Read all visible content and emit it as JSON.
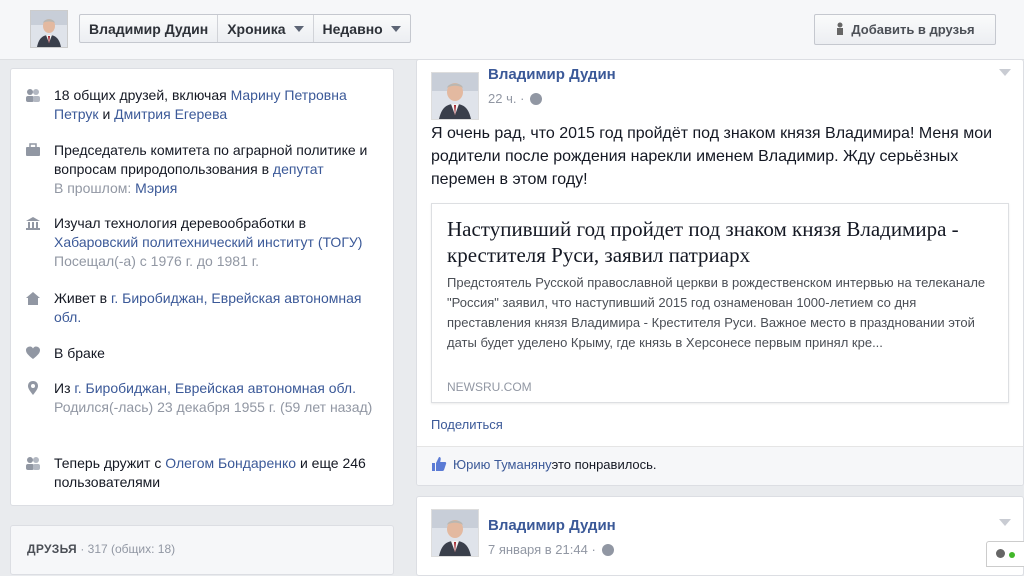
{
  "header": {
    "name": "Владимир Дудин",
    "tab_timeline": "Хроника",
    "tab_recent": "Недавно",
    "add_friend": "Добавить в друзья"
  },
  "intro": {
    "mutual_prefix": "18 общих друзей, включая ",
    "mutual_friend1": "Марину Петровна Петрук",
    "mutual_and": " и ",
    "mutual_friend2": "Дмитрия Егерева",
    "work_prefix": "Председатель комитета по аграрной политике и вопросам природопользования в ",
    "work_link": "депутат",
    "work_past_label": "В прошлом: ",
    "work_past_link": "Мэрия",
    "edu_prefix": "Изучал технология деревообработки в ",
    "edu_link": "Хабаровский политехнический институт (ТОГУ)",
    "edu_years": "Посещал(-а) с 1976 г. до 1981 г.",
    "lives_prefix": "Живет в ",
    "lives_link1": "г. Биробиджан",
    "lives_sep": ", ",
    "lives_link2": "Еврейская автономная обл.",
    "relationship": "В браке",
    "from_prefix": "Из ",
    "from_link1": "г. Биробиджан",
    "from_sep": ", ",
    "from_link2": "Еврейская автономная обл.",
    "born": "Родился(-лась) 23 декабря 1955 г. (59 лет назад)",
    "friends_with_prefix": "Теперь дружит с ",
    "friends_with_link": "Олегом Бондаренко",
    "friends_with_suffix": " и еще 246 пользователями"
  },
  "friends_box": {
    "title": "ДРУЗЬЯ",
    "sep": " · ",
    "count": "317 (общих: 18)"
  },
  "post1": {
    "author": "Владимир Дудин",
    "time": "22 ч. ·",
    "text": "Я очень рад, что 2015 год пройдёт под знаком князя Владимира! Меня мои родители после рождения нарекли именем Владимир. Жду серьёзных перемен в этом году!",
    "link_title": "Наступивший год пройдет под знаком князя Владимира - крестителя Руси, заявил патриарх",
    "link_desc": "Предстоятель Русской православной церкви в рождественском интервью на телеканале \"Россия\" заявил, что наступивший 2015 год ознаменован 1000-летием со дня преставления князя Владимира - Крестителя Руси. Важное место в праздновании этой даты будет уделено Крыму, где князь в Херсонесе первым принял кре...",
    "link_source": "NEWSRU.COM",
    "share": "Поделиться",
    "liker": "Юрию Туманяну",
    "likes_suffix": " это понравилось."
  },
  "post2": {
    "author": "Владимир Дудин",
    "time": "7 января в 21:44 ·"
  },
  "icons": {
    "people": "people-icon",
    "work": "briefcase-icon",
    "education": "school-icon",
    "home": "house-icon",
    "heart": "heart-icon",
    "location": "pin-icon",
    "globe": "globe-icon"
  },
  "colors": {
    "link": "#3b5998",
    "muted": "#9197a3",
    "background": "#e9ebee"
  }
}
